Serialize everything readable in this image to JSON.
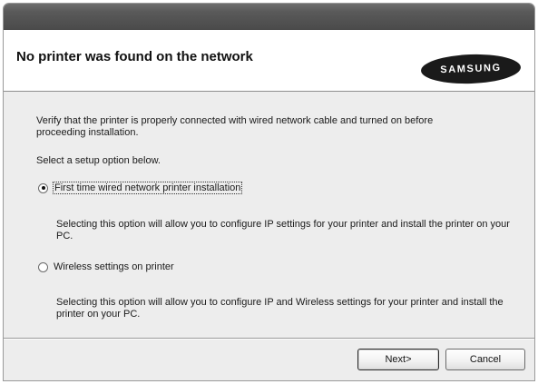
{
  "header": {
    "title": "No printer was found on the network",
    "logo_text": "SAMSUNG"
  },
  "content": {
    "verify_text": "Verify that the printer is properly connected with wired network cable and turned on before proceeding installation.",
    "select_prompt": "Select a setup option below.",
    "options": [
      {
        "label": "First time wired network printer installation",
        "selected": true,
        "description": "Selecting this option will allow you to configure IP settings for your printer and install the printer on your PC."
      },
      {
        "label": "Wireless settings on printer",
        "selected": false,
        "description": "Selecting this option will allow you to configure IP and Wireless settings for your printer and install the printer on your PC."
      }
    ]
  },
  "buttons": {
    "next": "Next>",
    "cancel": "Cancel"
  },
  "colors": {
    "titlebar": "#555555",
    "dialog_bg": "#ededed",
    "header_bg": "#ffffff"
  }
}
